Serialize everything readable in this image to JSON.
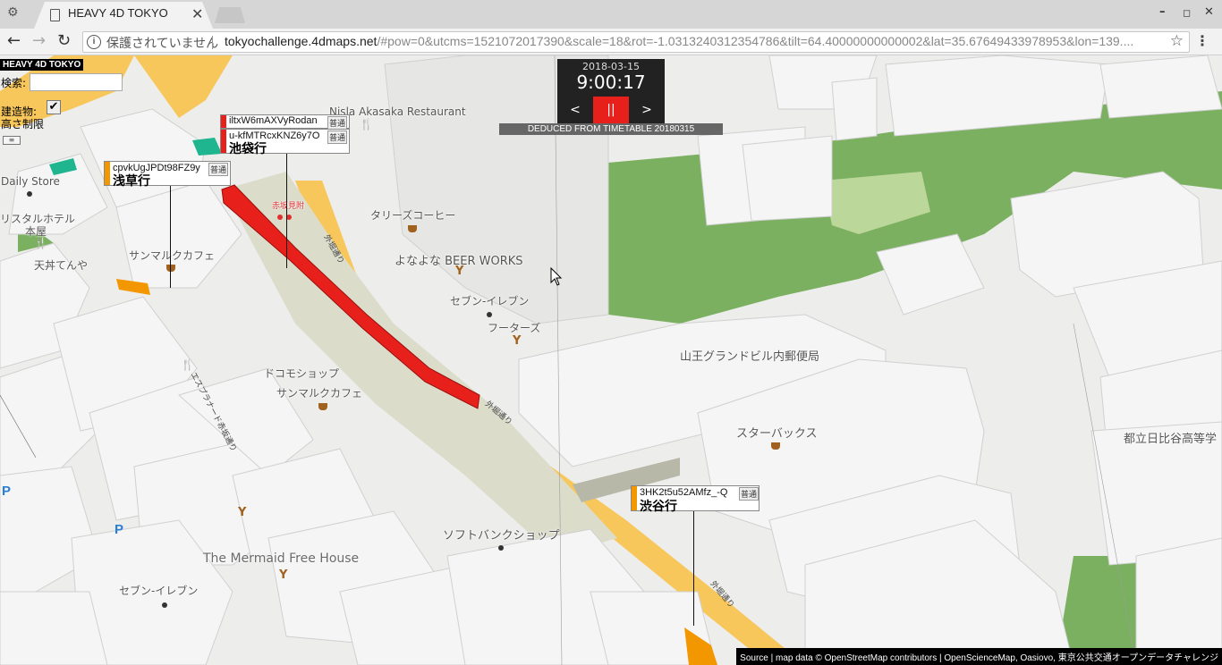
{
  "browser": {
    "tab_title": "HEAVY 4D TOKYO",
    "security_text": "保護されていません",
    "url_host": "tokyochallenge.4dmaps.net",
    "url_path": "/#pow=0&utcms=1521072017390&scale=18&rot=-1.0313240312354786&tilt=64.40000000000002&lat=35.67649433978953&lon=139...."
  },
  "app": {
    "title": "HEAVY 4D TOKYO",
    "search_label": "検索:",
    "search_value": "",
    "building_label_line1": "建造物:",
    "building_label_line2": "高さ制限",
    "building_checked": true
  },
  "clock": {
    "date": "2018-03-15",
    "time": "9:00:17",
    "prev_label": "<",
    "pause_label": "||",
    "next_label": ">",
    "deduced_text": "DEDUCED FROM TIMETABLE 20180315"
  },
  "trains": [
    {
      "id": "iltxW6mAXVyRodan",
      "kind": "普通",
      "dest": "",
      "color": "#e8201c"
    },
    {
      "id": "u-kfMTRcxKNZ6y7O",
      "kind": "普通",
      "dest": "池袋行",
      "color": "#e8201c"
    },
    {
      "id": "cpvkUgJPDt98FZ9y",
      "kind": "普通",
      "dest": "浅草行",
      "color": "#f39700"
    },
    {
      "id": "3HK2t5u52AMfz_-Q",
      "kind": "普通",
      "dest": "渋谷行",
      "color": "#f39700"
    }
  ],
  "map_labels": {
    "restaurant": "Nisla Akasaka Restaurant",
    "tullys": "タリーズコーヒー",
    "beer": "よなよな BEER WORKS",
    "seven1": "セブン-イレブン",
    "footers": "フーターズ",
    "sanno": "山王グランドビル内郵便局",
    "starbucks": "スターバックス",
    "hibiya": "都立日比谷高等学",
    "docomo": "ドコモショップ",
    "saint_marc1": "サンマルクカフェ",
    "saint_marc2": "サンマルクカフェ",
    "softbank": "ソフトバンクショップ",
    "mermaid": "The Mermaid Free House",
    "seven2": "セブン-イレブン",
    "daily": "Daily Store",
    "crystal": "リスタルホテル",
    "honya": "本屋",
    "tendon": "天丼てんや",
    "akasaka_mitsuke": "赤坂見附",
    "street1": "外堀通り",
    "street2": "外堀通り",
    "street3": "エスプラナード赤坂通り",
    "street4": "外堀通り"
  },
  "attribution": "Source | map data © OpenStreetMap contributors | OpenScienceMap, Oasiovo, 東京公共交通オープンデータチャレンジ",
  "colors": {
    "ginza_line": "#f39700",
    "marunouchi_line": "#e8201c",
    "park": "#7bb061",
    "road": "#f7c75c"
  }
}
